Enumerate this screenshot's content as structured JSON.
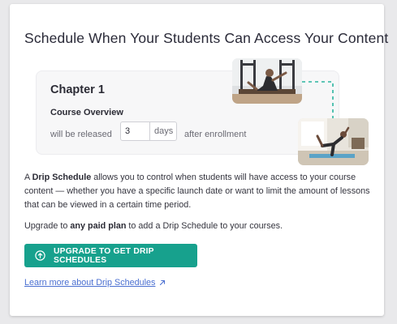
{
  "heading": "Schedule When Your Students Can Access Your Content",
  "preview": {
    "chapter_title": "Chapter 1",
    "lesson_title": "Course Overview",
    "release_prefix": "will be released",
    "days_value": "3",
    "days_unit": "days",
    "release_suffix": "after enrollment"
  },
  "description": {
    "brand": "Drip Schedule",
    "text": "allows you to control when students will have access to your course content — whether you have a specific launch date or want to limit the amount of lessons that can be viewed in a certain time period."
  },
  "upgrade_note": {
    "prefix": "Upgrade to",
    "emphasis": "any paid plan",
    "suffix": "to add a Drip Schedule to your courses."
  },
  "upgrade_button": {
    "label": "UPGRADE TO GET DRIP SCHEDULES",
    "icon": "arrow-up-circle-icon"
  },
  "learn_more": {
    "label": "Learn more about Drip Schedules",
    "icon": "external-arrow-icon"
  },
  "colors": {
    "accent": "#17a18d",
    "link": "#4a6fd1",
    "dashed_connector": "#2bb5a0"
  }
}
